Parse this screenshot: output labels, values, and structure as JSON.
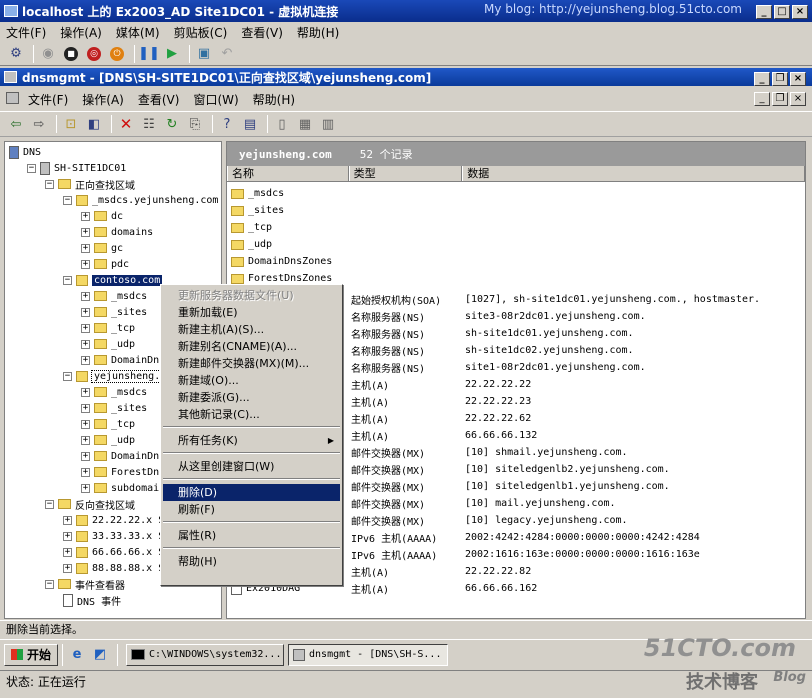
{
  "vm_title": "localhost 上的 Ex2003_AD Site1DC01 - 虚拟机连接",
  "blog": "My blog: http://yejunsheng.blog.51cto.com",
  "vm_menu": [
    "文件(F)",
    "操作(A)",
    "媒体(M)",
    "剪贴板(C)",
    "查看(V)",
    "帮助(H)"
  ],
  "mmc_title": "dnsmgmt - [DNS\\SH-SITE1DC01\\正向查找区域\\yejunsheng.com]",
  "mmc_menu": [
    "文件(F)",
    "操作(A)",
    "查看(V)",
    "窗口(W)",
    "帮助(H)"
  ],
  "tree": [
    {
      "label": "DNS",
      "level": 0,
      "type": "dns"
    },
    {
      "label": "SH-SITE1DC01",
      "level": 1,
      "type": "server",
      "exp": "-"
    },
    {
      "label": "正向查找区域",
      "level": 2,
      "type": "folder",
      "exp": "-"
    },
    {
      "label": "_msdcs.yejunsheng.com",
      "level": 3,
      "type": "zone",
      "exp": "-"
    },
    {
      "label": "dc",
      "level": 4,
      "type": "folder",
      "exp": "+"
    },
    {
      "label": "domains",
      "level": 4,
      "type": "folder",
      "exp": "+"
    },
    {
      "label": "gc",
      "level": 4,
      "type": "folder",
      "exp": "+"
    },
    {
      "label": "pdc",
      "level": 4,
      "type": "folder",
      "exp": "+"
    },
    {
      "label": "contoso.com",
      "level": 3,
      "type": "zone",
      "exp": "-",
      "selected": true
    },
    {
      "label": "_msdcs",
      "level": 4,
      "type": "folder",
      "exp": "+"
    },
    {
      "label": "_sites",
      "level": 4,
      "type": "folder",
      "exp": "+"
    },
    {
      "label": "_tcp",
      "level": 4,
      "type": "folder",
      "exp": "+"
    },
    {
      "label": "_udp",
      "level": 4,
      "type": "folder",
      "exp": "+"
    },
    {
      "label": "DomainDnsZ",
      "level": 4,
      "type": "folder",
      "exp": "+"
    },
    {
      "label": "yejunsheng.c",
      "level": 3,
      "type": "zone",
      "exp": "-",
      "boxed": true
    },
    {
      "label": "_msdcs",
      "level": 4,
      "type": "folder",
      "exp": "+"
    },
    {
      "label": "_sites",
      "level": 4,
      "type": "folder",
      "exp": "+"
    },
    {
      "label": "_tcp",
      "level": 4,
      "type": "folder",
      "exp": "+"
    },
    {
      "label": "_udp",
      "level": 4,
      "type": "folder",
      "exp": "+"
    },
    {
      "label": "DomainDns",
      "level": 4,
      "type": "folder",
      "exp": "+"
    },
    {
      "label": "ForestDns",
      "level": 4,
      "type": "folder",
      "exp": "+"
    },
    {
      "label": "subdomain",
      "level": 4,
      "type": "folder",
      "exp": "+"
    },
    {
      "label": "反向查找区域",
      "level": 2,
      "type": "folder",
      "exp": "-"
    },
    {
      "label": "22.22.22.x S",
      "level": 3,
      "type": "zone",
      "exp": "+"
    },
    {
      "label": "33.33.33.x S",
      "level": 3,
      "type": "zone",
      "exp": "+"
    },
    {
      "label": "66.66.66.x S",
      "level": 3,
      "type": "zone",
      "exp": "+"
    },
    {
      "label": "88.88.88.x S",
      "level": 3,
      "type": "zone",
      "exp": "+"
    },
    {
      "label": "事件查看器",
      "level": 2,
      "type": "folder",
      "exp": "-"
    },
    {
      "label": "DNS 事件",
      "level": 3,
      "type": "log"
    }
  ],
  "right_header": {
    "zone": "yejunsheng.com",
    "count": "52 个记录"
  },
  "columns": [
    "名称",
    "类型",
    "数据"
  ],
  "folders": [
    "_msdcs",
    "_sites",
    "_tcp",
    "_udp",
    "DomainDnsZones",
    "ForestDnsZones"
  ],
  "records": [
    {
      "type": "起始授权机构(SOA)",
      "data": "[1027], sh-site1dc01.yejunsheng.com., hostmaster."
    },
    {
      "type": "名称服务器(NS)",
      "data": "site3-08r2dc01.yejunsheng.com."
    },
    {
      "type": "名称服务器(NS)",
      "data": "sh-site1dc01.yejunsheng.com."
    },
    {
      "type": "名称服务器(NS)",
      "data": "sh-site1dc02.yejunsheng.com."
    },
    {
      "type": "名称服务器(NS)",
      "data": "site1-08r2dc01.yejunsheng.com."
    },
    {
      "type": "主机(A)",
      "data": "22.22.22.22"
    },
    {
      "type": "主机(A)",
      "data": "22.22.22.23"
    },
    {
      "type": "主机(A)",
      "data": "22.22.22.62"
    },
    {
      "type": "主机(A)",
      "data": "66.66.66.132"
    },
    {
      "type": "邮件交换器(MX)",
      "data": "[10]  shmail.yejunsheng.com."
    },
    {
      "type": "邮件交换器(MX)",
      "data": "[10]  siteledgenlb2.yejunsheng.com."
    },
    {
      "type": "邮件交换器(MX)",
      "data": "[10]  siteledgenlb1.yejunsheng.com."
    },
    {
      "type": "邮件交换器(MX)",
      "data": "[10]  mail.yejunsheng.com."
    },
    {
      "type": "邮件交换器(MX)",
      "data": "[10]  legacy.yejunsheng.com."
    },
    {
      "type": "IPv6 主机(AAAA)",
      "data": "2002:4242:4284:0000:0000:0000:4242:4284"
    },
    {
      "type": "IPv6 主机(AAAA)",
      "data": "2002:1616:163e:0000:0000:0000:1616:163e"
    },
    {
      "type": "主机(A)",
      "data": "22.22.22.82"
    },
    {
      "type": "主机(A)",
      "data": "66.66.66.162",
      "name": "Ex2010DAG"
    }
  ],
  "context_menu": [
    {
      "label": "更新服务器数据文件(U)",
      "disabled": true
    },
    {
      "label": "重新加载(E)"
    },
    {
      "label": "新建主机(A)(S)..."
    },
    {
      "label": "新建别名(CNAME)(A)..."
    },
    {
      "label": "新建邮件交换器(MX)(M)..."
    },
    {
      "label": "新建域(O)..."
    },
    {
      "label": "新建委派(G)..."
    },
    {
      "label": "其他新记录(C)..."
    },
    {
      "sep": true
    },
    {
      "label": "所有任务(K)",
      "submenu": true
    },
    {
      "sep": true
    },
    {
      "label": "从这里创建窗口(W)"
    },
    {
      "sep": true
    },
    {
      "label": "删除(D)",
      "highlighted": true
    },
    {
      "label": "刷新(F)"
    },
    {
      "sep": true
    },
    {
      "label": "属性(R)"
    },
    {
      "sep": true
    },
    {
      "label": "帮助(H)"
    }
  ],
  "status_text": "删除当前选择。",
  "taskbar": {
    "start": "开始",
    "tasks": [
      "C:\\WINDOWS\\system32...",
      "dnsmgmt - [DNS\\SH-S..."
    ]
  },
  "vm_status": "状态:  正在运行",
  "watermark": {
    "site": "51CTO.com",
    "sub": "技术博客",
    "blog": "Blog"
  },
  "colors": {
    "title_blue": "#0a2d8c",
    "highlight": "#0a246a",
    "header_gray": "#9a9a9a"
  }
}
